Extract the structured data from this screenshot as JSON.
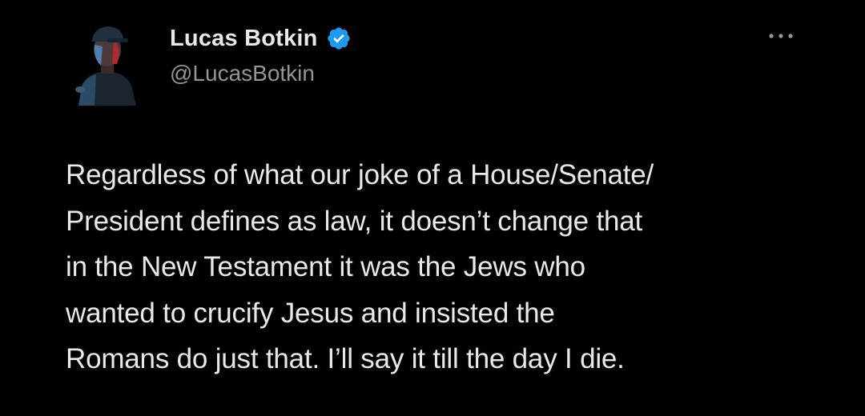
{
  "author": {
    "display_name": "Lucas Botkin",
    "handle": "@LucasBotkin",
    "verified": true,
    "verified_icon": "verified-badge-icon",
    "avatar": "profile-avatar"
  },
  "menu": {
    "icon": "more-options-icon"
  },
  "tweet": {
    "lines": [
      "Regardless of what our joke of a House/Senate/",
      "President defines as law, it doesn’t change that",
      "in the New Testament it was the Jews who",
      "wanted to crucify Jesus and insisted the",
      "Romans do just that. I’ll say it till the day I die."
    ]
  },
  "colors": {
    "background": "#000000",
    "text_primary": "#e7e9ea",
    "text_secondary": "#8f969c",
    "verified_blue": "#1d9bf0"
  }
}
